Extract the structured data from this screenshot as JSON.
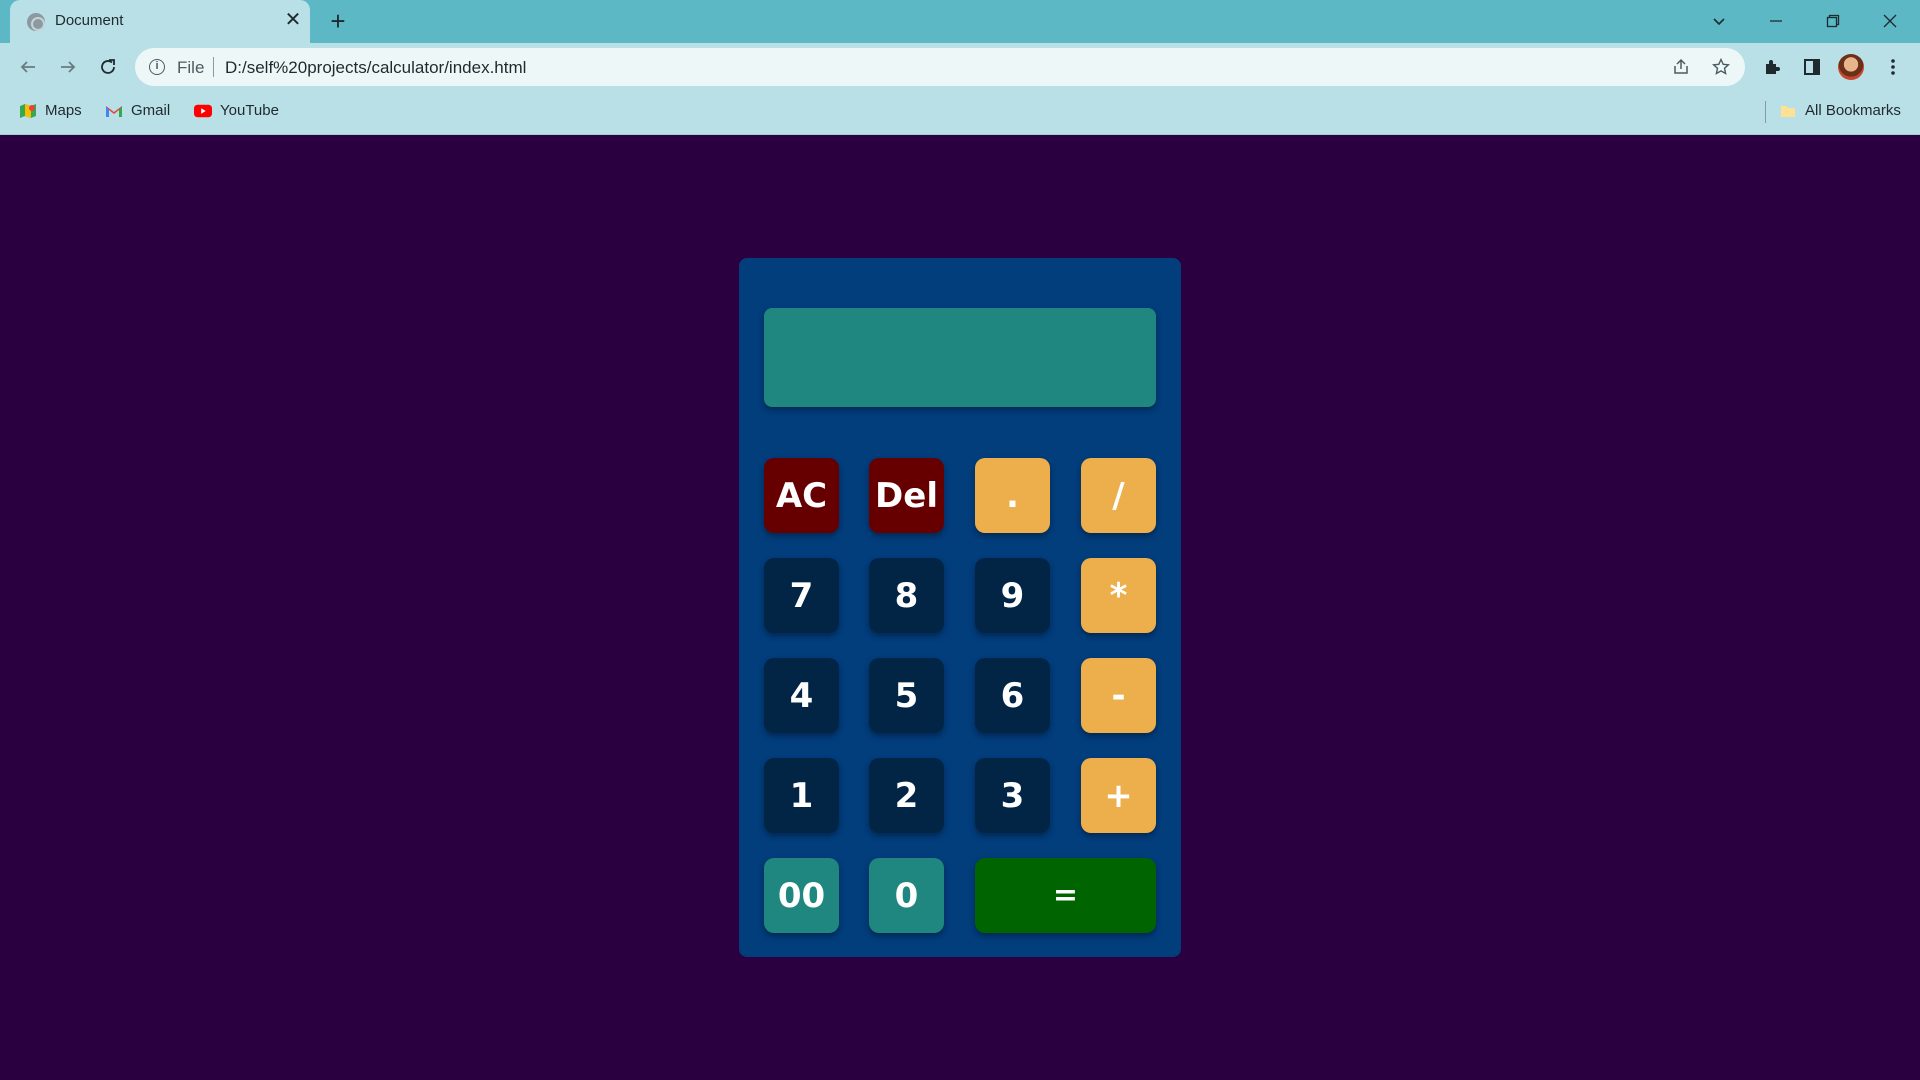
{
  "browser": {
    "tab_title": "Document",
    "tab_close": "✕",
    "new_tab": "+",
    "address_scheme": "File",
    "address_url": "D:/self%20projects/calculator/index.html",
    "bookmarks": [
      {
        "label": "Maps",
        "icon": "maps-icon"
      },
      {
        "label": "Gmail",
        "icon": "gmail-icon"
      },
      {
        "label": "YouTube",
        "icon": "youtube-icon"
      }
    ],
    "all_bookmarks": "All Bookmarks"
  },
  "calculator": {
    "display_value": "",
    "keys": {
      "ac": "AC",
      "del": "Del",
      "dot": ".",
      "divide": "/",
      "seven": "7",
      "eight": "8",
      "nine": "9",
      "multiply": "*",
      "four": "4",
      "five": "5",
      "six": "6",
      "minus": "-",
      "one": "1",
      "two": "2",
      "three": "3",
      "plus": "+",
      "double_zero": "00",
      "zero": "0",
      "equals": "="
    }
  },
  "colors": {
    "page_background": "#2a0040",
    "calculator_body": "#023d7c",
    "display": "#1f8780",
    "danger_key": "#660000",
    "operator_key": "#edaf4b",
    "number_key": "#022546",
    "teal_key": "#1f8780",
    "equals_key": "#006400"
  }
}
